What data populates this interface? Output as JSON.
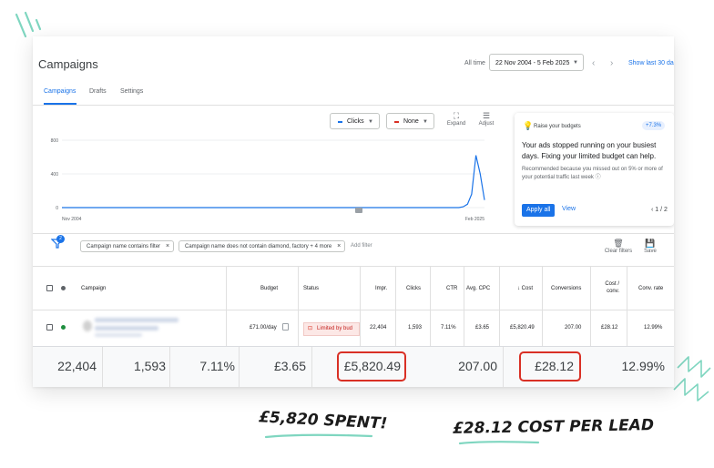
{
  "header": {
    "title": "Campaigns",
    "all_time_label": "All time",
    "date_range": "22 Nov 2004 - 5 Feb 2025",
    "show_last": "Show last 30 da"
  },
  "tabs": [
    {
      "label": "Campaigns",
      "active": true
    },
    {
      "label": "Drafts",
      "active": false
    },
    {
      "label": "Settings",
      "active": false
    }
  ],
  "chart_controls": {
    "metric1": "Clicks",
    "metric1_color": "#1a73e8",
    "metric2": "None",
    "metric2_color": "#d93025",
    "expand_label": "Expand",
    "adjust_label": "Adjust"
  },
  "chart_data": {
    "type": "line",
    "x_labels": [
      "Nov 2004",
      "Feb 2025"
    ],
    "y_ticks": [
      "800",
      "400",
      "0"
    ],
    "ylim": [
      0,
      800
    ],
    "series": [
      {
        "color": "#1a73e8",
        "values": [
          0,
          0,
          0,
          0,
          0,
          0,
          0,
          0,
          0,
          0,
          0,
          0,
          0,
          0,
          0,
          0,
          0,
          0,
          0,
          0,
          0,
          0,
          0,
          0,
          0,
          0,
          0,
          0,
          0,
          0,
          0,
          0,
          0,
          0,
          0,
          0,
          0,
          0,
          0,
          0,
          0,
          0,
          0,
          0,
          0,
          0,
          0,
          0,
          0,
          0,
          0,
          0,
          0,
          0,
          0,
          0,
          0,
          0,
          0,
          0,
          0,
          0,
          0,
          0,
          0,
          0,
          0,
          0,
          0,
          0,
          0,
          0,
          0,
          0,
          0,
          0,
          0,
          0,
          0,
          0,
          0,
          0,
          0,
          0,
          0,
          0,
          0,
          0,
          0,
          0,
          0,
          0,
          0,
          0,
          10,
          40,
          160,
          620,
          400,
          90
        ]
      }
    ],
    "grid": true
  },
  "recommendation": {
    "header": "Raise your budgets",
    "badge": "+7.3%",
    "body": "Your ads stopped running on your busiest days. Fixing your limited budget can help.",
    "note": "Recommended because you missed out on 5% or more of your potential traffic last week",
    "apply_label": "Apply all",
    "view_label": "View",
    "pager": "1 / 2"
  },
  "filters": {
    "badge": "2",
    "chips": [
      "Campaign name contains filter",
      "Campaign name does not contain diamond, factory + 4 more"
    ],
    "add_filter": "Add filter",
    "clear_label": "Clear filters",
    "save_label": "Save"
  },
  "table": {
    "headers": {
      "campaign": "Campaign",
      "budget": "Budget",
      "status": "Status",
      "impr": "Impr.",
      "clicks": "Clicks",
      "ctr": "CTR",
      "avg_cpc": "Avg. CPC",
      "cost": "↓ Cost",
      "conversions": "Conversions",
      "cost_conv_1": "Cost /",
      "cost_conv_2": "conv.",
      "conv_rate": "Conv. rate"
    },
    "row": {
      "budget": "£71.00/day",
      "status": "Limited by bud",
      "impr": "22,404",
      "clicks": "1,593",
      "ctr": "7.11%",
      "avg_cpc": "£3.65",
      "cost": "£5,820.49",
      "conversions": "207.00",
      "cost_conv": "£28.12",
      "conv_rate": "12.99%",
      "status_dot_color": "#1e8e3e"
    },
    "totals": {
      "impr": "22,404",
      "clicks": "1,593",
      "ctr": "7.11%",
      "avg_cpc": "£3.65",
      "cost": "£5,820.49",
      "conversions": "207.00",
      "cost_conv": "£28.12",
      "conv_rate": "12.99%"
    }
  },
  "annotations": {
    "spent": "£5,820 SPENT!",
    "cpl": "£28.12 COST PER LEAD"
  },
  "colors": {
    "highlight": "#d93025",
    "accent": "#1a73e8",
    "doodle": "#7fd6c0"
  }
}
